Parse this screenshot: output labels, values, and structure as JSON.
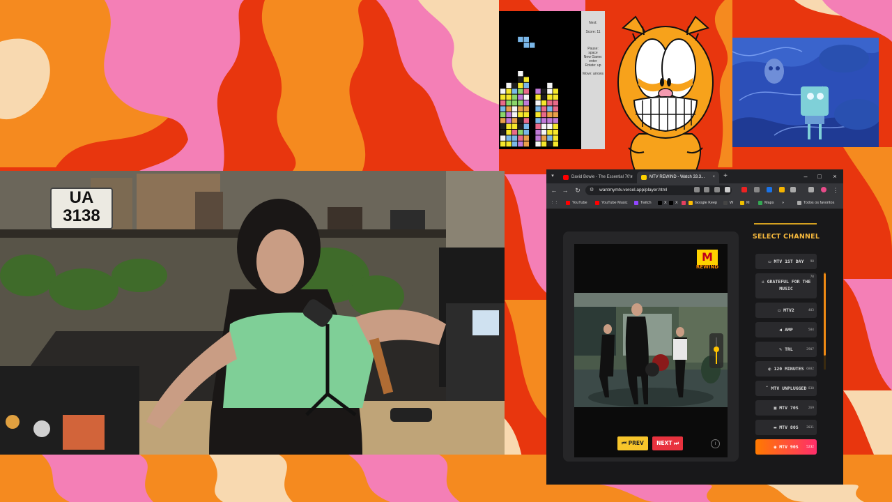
{
  "colors": {
    "bg_red": "#e8360e",
    "bg_orange": "#f58a1f",
    "bg_pink": "#f47fb6",
    "bg_cream": "#f8d9b0",
    "mtv_yellow": "#f5b83d",
    "mtv_pink": "#ff2d6b"
  },
  "tetris": {
    "sidebar_lines": [
      "Next: ",
      "Score: 11",
      "",
      "Pause: space",
      "New Game: enter",
      "Rotate: up",
      "Move: arrows"
    ]
  },
  "webcam": {
    "plate_line1": "UA",
    "plate_line2": "3138"
  },
  "browser": {
    "tabs": [
      {
        "title": "David Bowie - The Essential 70's",
        "icon": "youtube-icon",
        "close": "×"
      },
      {
        "title": "MTV REWIND - Watch 33.3...",
        "icon": "mtv-icon",
        "close": "×"
      }
    ],
    "new_tab": "+",
    "window_controls": {
      "minimize": "–",
      "maximize": "□",
      "close": "×"
    },
    "nav": {
      "back": "←",
      "forward": "→",
      "reload": "↻"
    },
    "url": "wantmymtv.vercel.app/player.html",
    "bookmarks": [
      {
        "label": "YouTube",
        "color": "#ff0000"
      },
      {
        "label": "YouTube Music",
        "color": "#ff0000"
      },
      {
        "label": "Twitch",
        "color": "#9146ff"
      },
      {
        "label": "X",
        "color": "#000000"
      },
      {
        "label": "X",
        "color": "#000000"
      },
      {
        "label": "",
        "color": "#e4405f"
      },
      {
        "label": "Google Keep",
        "color": "#fbbc04"
      },
      {
        "label": "W",
        "color": "#444444"
      },
      {
        "label": "M",
        "color": "#f0c000"
      },
      {
        "label": "Maps",
        "color": "#34a853"
      }
    ],
    "bookmarks_more": "»",
    "bookmarks_all": "Todos os favoritos"
  },
  "player": {
    "logo_m": "M",
    "logo_sub": "REWIND",
    "prev_label": "⏮ PREV",
    "next_label": "NEXT ⏭",
    "info": "i",
    "volume_level": 0.55
  },
  "channels": {
    "title": "SELECT CHANNEL",
    "items": [
      {
        "label": "MTV 1ST DAY",
        "icon": "tv-icon",
        "glyph": "▭",
        "num": "98",
        "active": false
      },
      {
        "label": "GRATEFUL FOR THE MUSIC",
        "icon": "skull-icon",
        "glyph": "☠",
        "num": "78",
        "active": false
      },
      {
        "label": "MTV2",
        "icon": "tv-icon",
        "glyph": "▭",
        "num": "403",
        "active": false
      },
      {
        "label": "AMP",
        "icon": "speaker-icon",
        "glyph": "◀",
        "num": "504",
        "active": false
      },
      {
        "label": "TRL",
        "icon": "mic-icon",
        "glyph": "✎",
        "num": "2907",
        "active": false
      },
      {
        "label": "120 MINUTES",
        "icon": "clock-icon",
        "glyph": "◐",
        "num": "6882",
        "active": false
      },
      {
        "label": "MTV UNPLUGGED",
        "icon": "plug-icon",
        "glyph": "ˇ",
        "num": "830",
        "active": false
      },
      {
        "label": "MTV 70S",
        "icon": "record-icon",
        "glyph": "▣",
        "num": "269",
        "active": false
      },
      {
        "label": "MTV 80S",
        "icon": "cassette-icon",
        "glyph": "▬",
        "num": "2031",
        "active": false
      },
      {
        "label": "MTV 90S",
        "icon": "disc-icon",
        "glyph": "◉",
        "num": "5232",
        "active": true
      }
    ]
  }
}
